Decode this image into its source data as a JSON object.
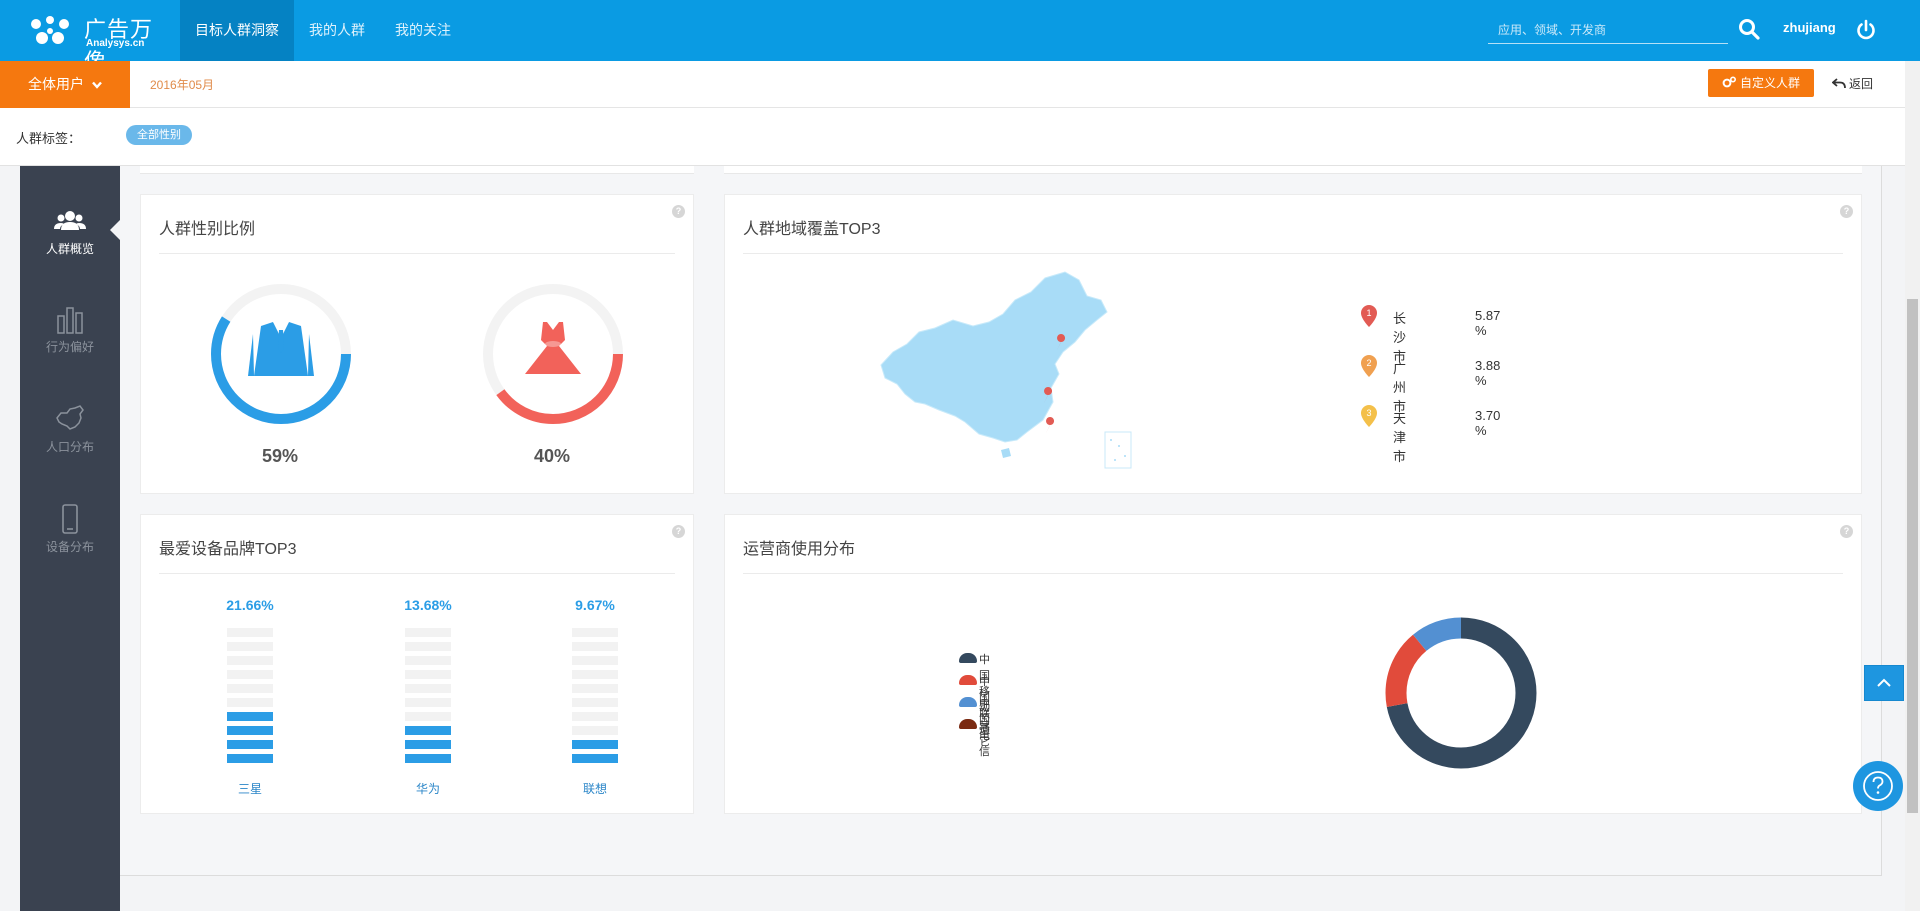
{
  "brand": {
    "name_cn": "广告万像",
    "name_en": "Analysys.cn"
  },
  "nav": {
    "items": [
      "目标人群洞察",
      "我的人群",
      "我的关注"
    ],
    "active": 0
  },
  "search": {
    "placeholder": "应用、领域、开发商"
  },
  "user": {
    "name": "zhujiang"
  },
  "subbar": {
    "scope_label": "全体用户",
    "date": "2016年05月",
    "custom_button": "自定义人群",
    "back_button": "返回"
  },
  "tags": {
    "label": "人群标签：",
    "active_tag": "全部性别"
  },
  "sidebar": {
    "items": [
      "人群概览",
      "行为偏好",
      "人口分布",
      "设备分布"
    ],
    "active": 0
  },
  "gender": {
    "title": "人群性别比例",
    "male": {
      "icon": "suit-icon",
      "percent_label": "59%",
      "value": 0.59,
      "color": "#2b9de6"
    },
    "female": {
      "icon": "dress-icon",
      "percent_label": "40%",
      "value": 0.4,
      "color": "#f2625a"
    }
  },
  "region": {
    "title": "人群地域覆盖TOP3",
    "map_color": "#a8dcf7",
    "marker_color": "#e25b54",
    "rows": [
      {
        "rank": "1",
        "city": "长沙市",
        "value": "5.87 %",
        "color": "#e25b54"
      },
      {
        "rank": "2",
        "city": "广州市",
        "value": "3.88 %",
        "color": "#f0a050"
      },
      {
        "rank": "3",
        "city": "天津市",
        "value": "3.70 %",
        "color": "#f4c04a"
      }
    ]
  },
  "devices": {
    "title": "最爱设备品牌TOP3",
    "brands": [
      {
        "name": "三星",
        "percent_label": "21.66%",
        "value": 21.66
      },
      {
        "name": "华为",
        "percent_label": "13.68%",
        "value": 13.68
      },
      {
        "name": "联想",
        "percent_label": "9.67%",
        "value": 9.67
      }
    ],
    "bar_color": "#2b9de6",
    "empty_color": "#f2f2f2"
  },
  "carrier": {
    "title": "运营商使用分布",
    "legend": [
      {
        "name": "中国移动",
        "color": "#34495e"
      },
      {
        "name": "中国联通",
        "color": "#e14b3b"
      },
      {
        "name": "中国电信",
        "color": "#5390d2"
      },
      {
        "name": "其它",
        "color": "#7a2a12"
      }
    ]
  },
  "chart_data": {
    "type": "pie",
    "categories": [
      "中国移动",
      "中国联通",
      "中国电信",
      "其它"
    ],
    "values": [
      72,
      17,
      11,
      0
    ],
    "title": "运营商使用分布",
    "donut": true,
    "legend_position": "left"
  }
}
